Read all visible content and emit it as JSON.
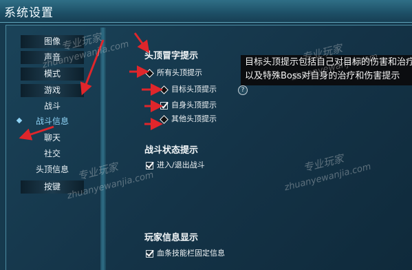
{
  "window": {
    "title": "系统设置"
  },
  "sidebar": {
    "items": [
      {
        "label": "图像"
      },
      {
        "label": "声音"
      },
      {
        "label": "模式"
      },
      {
        "label": "游戏"
      },
      {
        "label": "战斗"
      },
      {
        "label": "战斗信息",
        "selected": true
      },
      {
        "label": "聊天"
      },
      {
        "label": "社交"
      },
      {
        "label": "头顶信息"
      },
      {
        "label": "按键"
      }
    ]
  },
  "sections": {
    "head_text": {
      "title": "头顶冒字提示",
      "options": [
        {
          "label": "所有头顶提示",
          "control": "diamond"
        },
        {
          "label": "目标头顶提示",
          "control": "diamond"
        },
        {
          "label": "自身头顶提示",
          "control": "checkbox",
          "checked": true
        },
        {
          "label": "其他头顶提示",
          "control": "diamond"
        }
      ]
    },
    "combat_state": {
      "title": "战斗状态提示",
      "options": [
        {
          "label": "进入/退出战斗",
          "control": "checkbox",
          "checked": true
        }
      ]
    },
    "player_info": {
      "title": "玩家信息显示",
      "options": [
        {
          "label": "血条技能栏固定信息",
          "control": "checkbox",
          "checked": true
        }
      ]
    }
  },
  "tooltip": {
    "line1": "目标头顶提示包括自己对目标的伤害和治疗",
    "line2": "以及特殊Boss对自身的治疗和伤害提示"
  },
  "help_icon": {
    "glyph": "?"
  },
  "watermarks": {
    "cn": "专业玩家",
    "en": "zhuanyewanjia.com"
  },
  "colors": {
    "background": "#163a4e",
    "selected_item": "#8fd3f5",
    "annotation_arrow": "#e0262b",
    "tooltip_bg": "#0b0d10"
  }
}
